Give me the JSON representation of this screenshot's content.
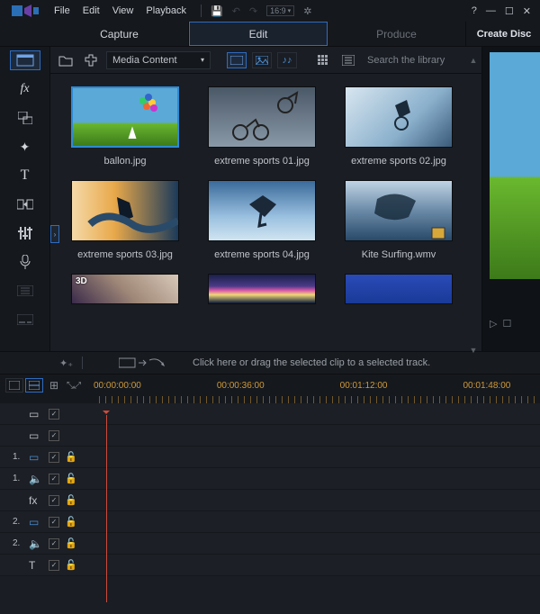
{
  "menu": {
    "file": "File",
    "edit": "Edit",
    "view": "View",
    "playback": "Playback"
  },
  "aspect_label": "16:9",
  "main_tabs": {
    "capture": "Capture",
    "edit": "Edit",
    "produce": "Produce",
    "create_disc": "Create Disc"
  },
  "library": {
    "dropdown": "Media Content",
    "search_placeholder": "Search the library"
  },
  "thumbs": [
    {
      "label": "ballon.jpg"
    },
    {
      "label": "extreme sports 01.jpg"
    },
    {
      "label": "extreme sports 02.jpg"
    },
    {
      "label": "extreme sports 03.jpg"
    },
    {
      "label": "extreme sports 04.jpg"
    },
    {
      "label": "Kite Surfing.wmv"
    }
  ],
  "tip": "Click here or drag the selected clip to a selected track.",
  "timecodes": [
    "00:00:00:00",
    "00:00:36:00",
    "00:01:12:00",
    "00:01:48:00"
  ],
  "tracks": [
    {
      "num": "",
      "icon": "▭",
      "iconClass": "w",
      "check": true,
      "lock": false
    },
    {
      "num": "",
      "icon": "▭",
      "iconClass": "w",
      "check": true,
      "lock": false
    },
    {
      "num": "1.",
      "icon": "▭",
      "iconClass": "",
      "check": true,
      "lock": true
    },
    {
      "num": "1.",
      "icon": "🔈",
      "iconClass": "",
      "check": true,
      "lock": true
    },
    {
      "num": "",
      "icon": "fx",
      "iconClass": "w",
      "check": true,
      "lock": true
    },
    {
      "num": "2.",
      "icon": "▭",
      "iconClass": "",
      "check": true,
      "lock": true
    },
    {
      "num": "2.",
      "icon": "🔈",
      "iconClass": "",
      "check": true,
      "lock": true
    },
    {
      "num": "",
      "icon": "T",
      "iconClass": "w",
      "check": true,
      "lock": true
    }
  ]
}
